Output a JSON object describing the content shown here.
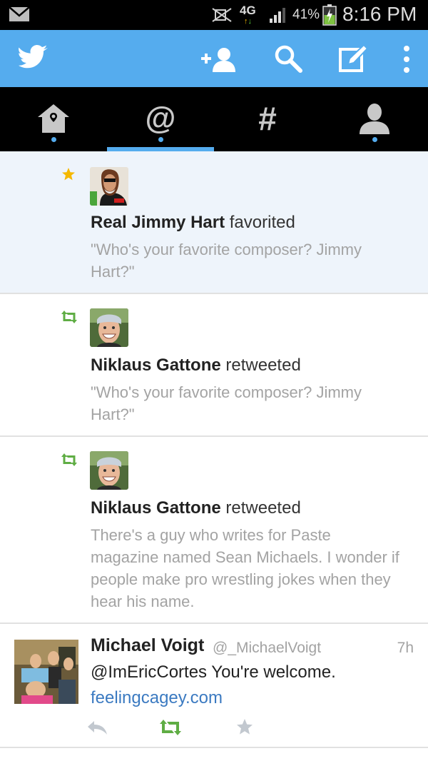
{
  "status_bar": {
    "network": "4G",
    "battery_percent": "41%",
    "time": "8:16 PM"
  },
  "app_bar": {
    "icons": [
      "twitter-bird-icon",
      "add-user-icon",
      "search-icon",
      "compose-icon",
      "overflow-menu-icon"
    ]
  },
  "tabs": [
    {
      "name": "home",
      "icon": "house-icon",
      "has_dot": true,
      "selected": false
    },
    {
      "name": "mentions",
      "icon": "at-sign-icon",
      "has_dot": true,
      "selected": true
    },
    {
      "name": "discover",
      "icon": "hashtag-icon",
      "has_dot": false,
      "selected": false
    },
    {
      "name": "profile",
      "icon": "person-icon",
      "has_dot": true,
      "selected": false
    }
  ],
  "feed": {
    "items": [
      {
        "type": "favorite",
        "name": "Real Jimmy Hart",
        "verb": "favorited",
        "tweet_line1": "\"Who's your favorite composer? Jimmy",
        "tweet_line2": "Hart?\""
      },
      {
        "type": "retweet",
        "name": "Niklaus Gattone",
        "verb": "retweeted",
        "tweet_line1": "\"Who's your favorite composer? Jimmy",
        "tweet_line2": "Hart?\""
      },
      {
        "type": "retweet",
        "name": "Niklaus Gattone",
        "verb": "retweeted",
        "tweet_line1": "There's a guy who writes for Paste",
        "tweet_line2": "magazine named Sean Michaels. I wonder if",
        "tweet_line3": "people make pro wrestling jokes when they",
        "tweet_line4": "hear his name."
      }
    ],
    "tweet": {
      "name": "Michael Voigt",
      "handle": "@_MichaelVoigt",
      "time": "7h",
      "text": "@ImEricCortes You're welcome.",
      "link": "feelingcagey.com"
    }
  },
  "colors": {
    "twitter_blue": "#55acee",
    "retweet_green": "#5fad44",
    "favorite_gold": "#f5b800",
    "highlight_bg": "#eef4fb",
    "link_blue": "#3b7ac1"
  }
}
